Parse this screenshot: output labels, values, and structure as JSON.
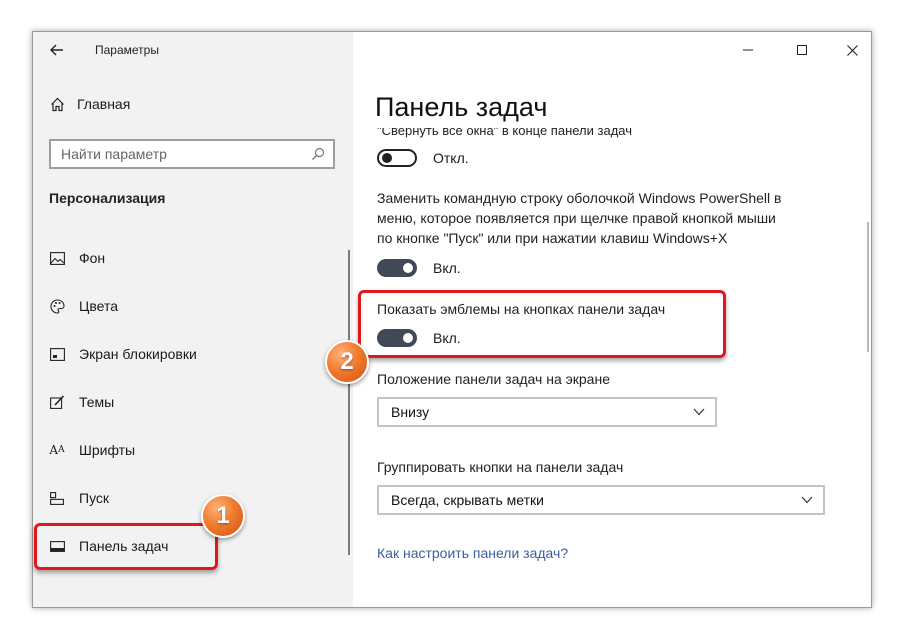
{
  "window": {
    "title": "Параметры"
  },
  "sidebar": {
    "home_label": "Главная",
    "search_placeholder": "Найти параметр",
    "section_title": "Персонализация",
    "items": [
      {
        "label": "Фон",
        "icon": "image-icon"
      },
      {
        "label": "Цвета",
        "icon": "palette-icon"
      },
      {
        "label": "Экран блокировки",
        "icon": "lock-screen-icon"
      },
      {
        "label": "Темы",
        "icon": "themes-icon"
      },
      {
        "label": "Шрифты",
        "icon": "fonts-icon"
      },
      {
        "label": "Пуск",
        "icon": "start-icon"
      },
      {
        "label": "Панель задач",
        "icon": "taskbar-icon"
      }
    ]
  },
  "main": {
    "title": "Панель задач",
    "cut_text": "\"Свернуть все окна\" в конце панели задач",
    "toggle1_state": "Откл.",
    "powershell_text_l1": "Заменить командную строку оболочкой Windows PowerShell в",
    "powershell_text_l2": "меню, которое появляется при щелчке правой кнопкой мыши",
    "powershell_text_l3": "по кнопке \"Пуск\" или при нажатии клавиш Windows+X",
    "toggle2_state": "Вкл.",
    "badges_label": "Показать эмблемы на кнопках панели задач",
    "toggle3_state": "Вкл.",
    "position_label": "Положение панели задач на экране",
    "position_value": "Внизу",
    "group_label": "Группировать кнопки на панели задач",
    "group_value": "Всегда, скрывать метки",
    "help_link": "Как настроить панели задач?"
  },
  "annotations": {
    "badge1": "1",
    "badge2": "2"
  },
  "colors": {
    "annotation": "#e0181b",
    "badge": "#f07c2f",
    "toggle_on": "#404a56",
    "link": "#3a5fa0"
  }
}
